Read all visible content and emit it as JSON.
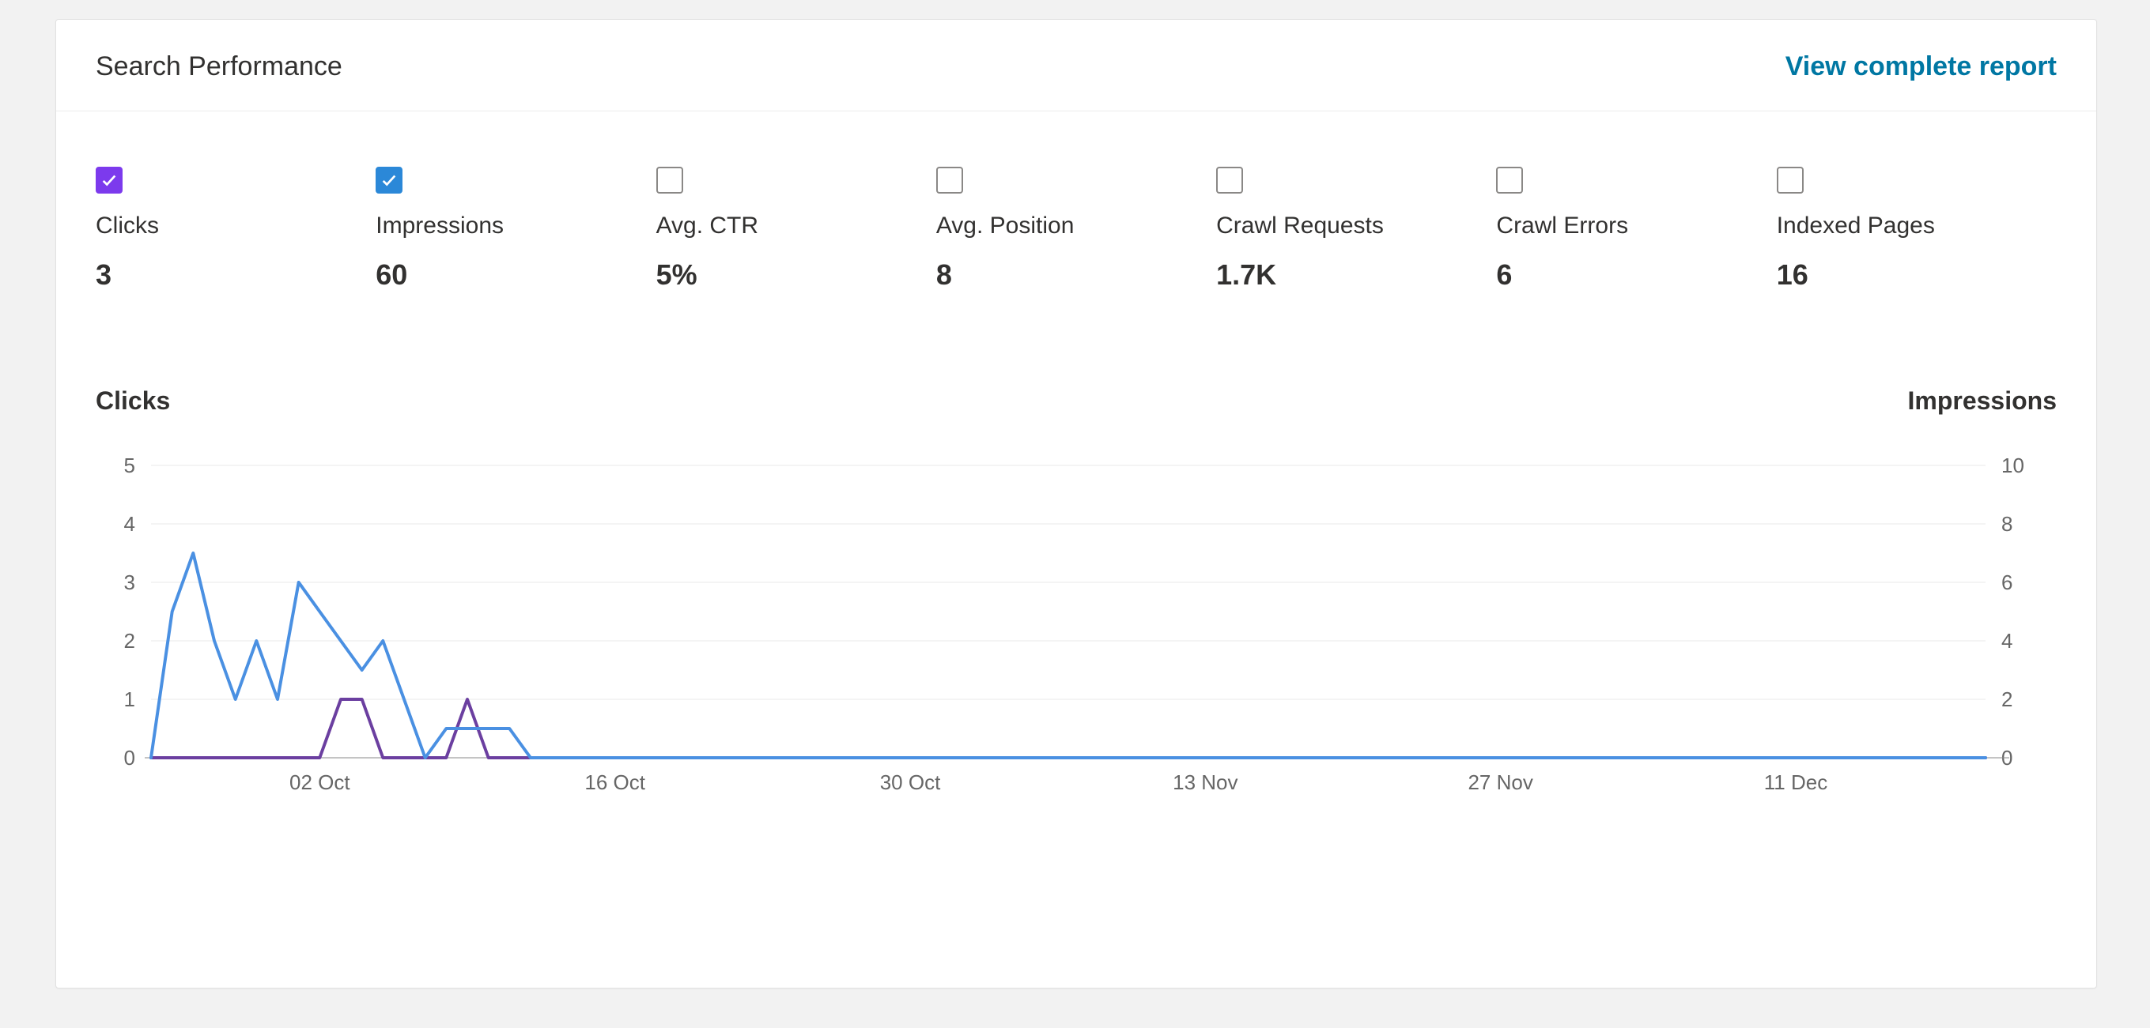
{
  "header": {
    "title": "Search Performance",
    "view_link": "View complete report"
  },
  "metrics": [
    {
      "key": "clicks",
      "label": "Clicks",
      "value": "3",
      "checked": true,
      "color": "purple"
    },
    {
      "key": "impressions",
      "label": "Impressions",
      "value": "60",
      "checked": true,
      "color": "blue"
    },
    {
      "key": "ctr",
      "label": "Avg. CTR",
      "value": "5%",
      "checked": false,
      "color": ""
    },
    {
      "key": "position",
      "label": "Avg. Position",
      "value": "8",
      "checked": false,
      "color": ""
    },
    {
      "key": "crawlreq",
      "label": "Crawl Requests",
      "value": "1.7K",
      "checked": false,
      "color": ""
    },
    {
      "key": "crawlerr",
      "label": "Crawl Errors",
      "value": "6",
      "checked": false,
      "color": ""
    },
    {
      "key": "indexed",
      "label": "Indexed Pages",
      "value": "16",
      "checked": false,
      "color": ""
    }
  ],
  "chart_labels": {
    "left_axis_title": "Clicks",
    "right_axis_title": "Impressions"
  },
  "chart_data": {
    "type": "line",
    "x_ticks": [
      "02 Oct",
      "16 Oct",
      "30 Oct",
      "13 Nov",
      "27 Nov",
      "11 Dec"
    ],
    "left_y_ticks": [
      0,
      1,
      2,
      3,
      4,
      5
    ],
    "right_y_ticks": [
      0,
      2,
      4,
      6,
      8,
      10
    ],
    "left_ylim": [
      0,
      5
    ],
    "right_ylim": [
      0,
      10
    ],
    "xlabel": "",
    "ylabel_left": "Clicks",
    "ylabel_right": "Impressions",
    "series": [
      {
        "name": "Clicks",
        "axis": "left",
        "color": "#6b3fa0",
        "values": [
          0,
          0,
          0,
          0,
          0,
          0,
          0,
          0,
          0,
          1,
          1,
          0,
          0,
          0,
          0,
          1,
          0,
          0,
          0,
          0,
          0,
          0,
          0,
          0,
          0,
          0,
          0,
          0,
          0,
          0,
          0,
          0,
          0,
          0,
          0,
          0,
          0,
          0,
          0,
          0,
          0,
          0,
          0,
          0,
          0,
          0,
          0,
          0,
          0,
          0,
          0,
          0,
          0,
          0,
          0,
          0,
          0,
          0,
          0,
          0,
          0,
          0,
          0,
          0,
          0,
          0,
          0,
          0,
          0,
          0,
          0,
          0,
          0,
          0,
          0,
          0,
          0,
          0,
          0,
          0,
          0,
          0,
          0,
          0,
          0,
          0,
          0,
          0
        ]
      },
      {
        "name": "Impressions",
        "axis": "right",
        "color": "#4a90e2",
        "values": [
          0,
          5,
          7,
          4,
          2,
          4,
          2,
          6,
          5,
          4,
          3,
          4,
          2,
          0,
          1,
          1,
          1,
          1,
          0,
          0,
          0,
          0,
          0,
          0,
          0,
          0,
          0,
          0,
          0,
          0,
          0,
          0,
          0,
          0,
          0,
          0,
          0,
          0,
          0,
          0,
          0,
          0,
          0,
          0,
          0,
          0,
          0,
          0,
          0,
          0,
          0,
          0,
          0,
          0,
          0,
          0,
          0,
          0,
          0,
          0,
          0,
          0,
          0,
          0,
          0,
          0,
          0,
          0,
          0,
          0,
          0,
          0,
          0,
          0,
          0,
          0,
          0,
          0,
          0,
          0,
          0,
          0,
          0,
          0,
          0,
          0,
          0,
          0
        ]
      }
    ],
    "x_tick_positions_days": [
      8,
      22,
      36,
      50,
      64,
      78
    ],
    "n_days": 88
  }
}
